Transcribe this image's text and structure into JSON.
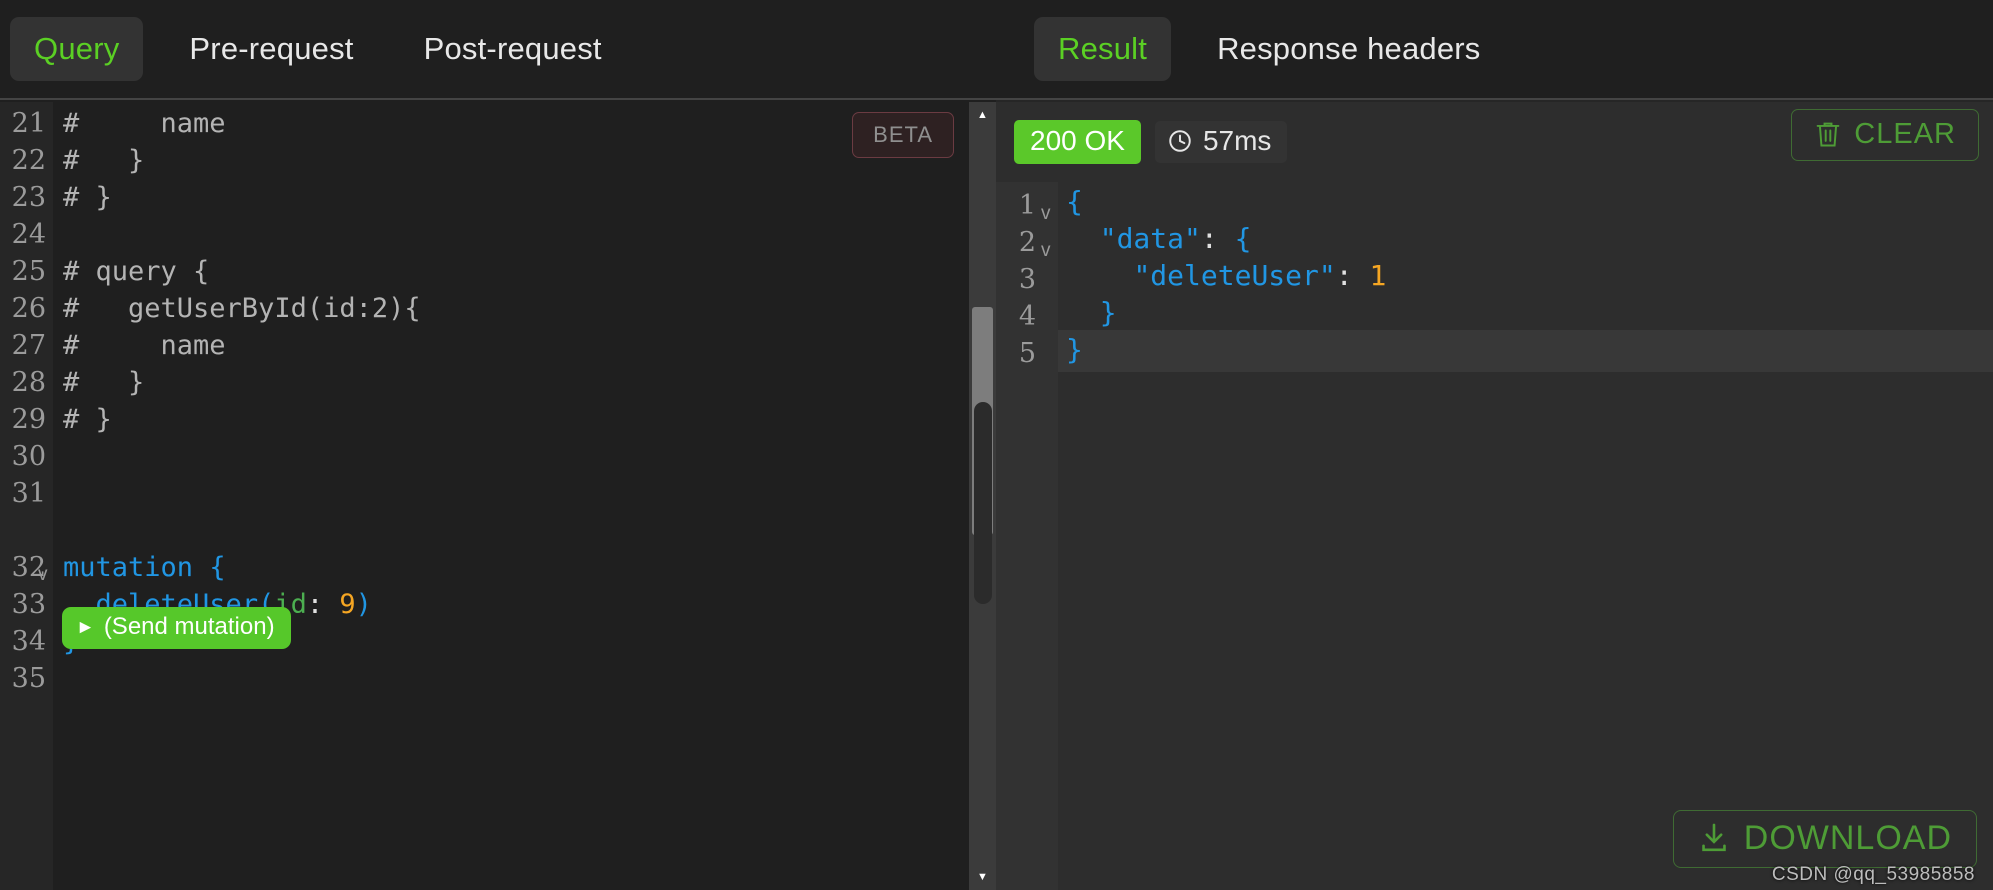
{
  "request_panel": {
    "tabs": [
      {
        "label": "Query",
        "active": true
      },
      {
        "label": "Pre-request",
        "active": false
      },
      {
        "label": "Post-request",
        "active": false
      }
    ],
    "beta_badge": "BETA",
    "send_button": {
      "icon": "play-icon",
      "label": "(Send mutation)"
    },
    "code_lines": [
      {
        "n": "21",
        "text": "#     name",
        "type": "comment"
      },
      {
        "n": "22",
        "text": "#   }",
        "type": "comment"
      },
      {
        "n": "23",
        "text": "# }",
        "type": "comment"
      },
      {
        "n": "24",
        "text": "",
        "type": "blank"
      },
      {
        "n": "25",
        "text": "# query {",
        "type": "comment"
      },
      {
        "n": "26",
        "text": "#   getUserById(id:2){",
        "type": "comment"
      },
      {
        "n": "27",
        "text": "#     name",
        "type": "comment"
      },
      {
        "n": "28",
        "text": "#   }",
        "type": "comment"
      },
      {
        "n": "29",
        "text": "# }",
        "type": "comment"
      },
      {
        "n": "30",
        "text": "",
        "type": "blank"
      },
      {
        "n": "31",
        "text": "",
        "type": "blank"
      },
      {
        "n": "32",
        "text": "mutation {",
        "type": "code",
        "fold": "v"
      },
      {
        "n": "33",
        "text": "  deleteUser(id: 9)",
        "type": "code"
      },
      {
        "n": "34",
        "text": "}",
        "type": "code"
      },
      {
        "n": "35",
        "text": "",
        "type": "blank"
      }
    ],
    "code_tokens": {
      "l32_kw": "mutation",
      "l32_brace": "{",
      "l33_fn": "deleteUser",
      "l33_paren_open": "(",
      "l33_arg": "id",
      "l33_colon": ":",
      "l33_num": "9",
      "l33_paren_close": ")",
      "l34_brace": "}"
    }
  },
  "response_panel": {
    "tabs": [
      {
        "label": "Result",
        "active": true
      },
      {
        "label": "Response headers",
        "active": false
      }
    ],
    "status": "200 OK",
    "duration": "57ms",
    "clear_button": "CLEAR",
    "download_button": "DOWNLOAD",
    "json_lines": [
      {
        "n": "1",
        "fold": "v",
        "indent": 0,
        "content": "{"
      },
      {
        "n": "2",
        "fold": "v",
        "indent": 1,
        "content": "\"data\": {"
      },
      {
        "n": "3",
        "fold": "",
        "indent": 2,
        "content": "\"deleteUser\": 1"
      },
      {
        "n": "4",
        "fold": "",
        "indent": 1,
        "content": "}"
      },
      {
        "n": "5",
        "fold": "",
        "indent": 0,
        "content": "}"
      }
    ],
    "json_tokens": {
      "l1_brace": "{",
      "l2_key": "\"data\"",
      "l2_colon": ":",
      "l2_brace": "{",
      "l3_key": "\"deleteUser\"",
      "l3_colon": ":",
      "l3_num": "1",
      "l4_brace": "}",
      "l5_brace": "}"
    }
  },
  "watermark": "CSDN @qq_53985858",
  "colors": {
    "accent_green": "#5bd024",
    "status_green": "#5bc82a",
    "keyword_blue": "#2196e3",
    "number_orange": "#f5a623",
    "arg_green": "#4caf50",
    "comment_gray": "#b4b4b4",
    "editor_bg": "#1f1f1f",
    "result_bg": "#2d2d2d"
  }
}
